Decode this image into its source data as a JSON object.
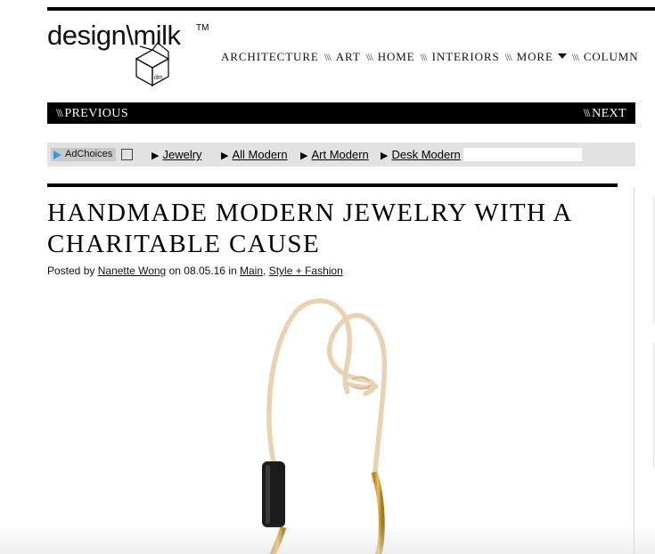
{
  "logo": {
    "brand": "design\\milk",
    "tm": "TM",
    "monogram": "dm"
  },
  "nav": {
    "items": [
      "ARCHITECTURE",
      "ART",
      "HOME",
      "INTERIORS",
      "MORE",
      "COLUMN"
    ],
    "separator": "\\\\\\"
  },
  "prevnext": {
    "marker": "\\\\\\",
    "previous": "PREVIOUS",
    "next": "NEXT"
  },
  "adbar": {
    "adchoices_label": "AdChoices",
    "links": [
      "Jewelry",
      "All Modern",
      "Art Modern",
      "Desk Modern"
    ],
    "arrow": "▶"
  },
  "article": {
    "title": "HANDMADE MODERN JEWELRY WITH A CHARITABLE CAUSE",
    "byline": {
      "posted_by": "Posted by",
      "author": "Nanette Wong",
      "on": "on",
      "date": "08.05.16",
      "in": "in",
      "category1": "Main",
      "comma": ",",
      "category2": "Style + Fashion"
    }
  },
  "colors": {
    "black": "#000000",
    "adbar_bg": "#e2e2e2",
    "cord": "#e9d2b4",
    "brass": "#d4a640",
    "bead": "#1b1b1b"
  }
}
